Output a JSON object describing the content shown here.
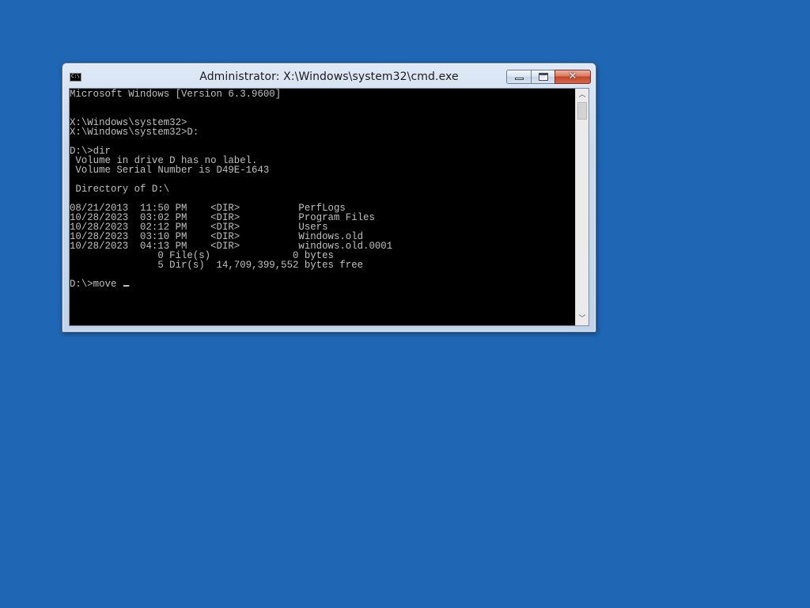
{
  "window": {
    "title": "Administrator: X:\\Windows\\system32\\cmd.exe",
    "icon": "cmd-icon",
    "icon_text": "C:\\",
    "buttons": {
      "minimize": "minimize-icon",
      "maximize": "maximize-icon",
      "close": "close-icon",
      "close_glyph": "✕"
    }
  },
  "console": {
    "text": "Microsoft Windows [Version 6.3.9600]\n\n\nX:\\Windows\\system32>\nX:\\Windows\\system32>D:\n\nD:\\>dir\n Volume in drive D has no label.\n Volume Serial Number is D49E-1643\n\n Directory of D:\\\n\n08/21/2013  11:50 PM    <DIR>          PerfLogs\n10/28/2023  03:02 PM    <DIR>          Program Files\n10/28/2023  02:12 PM    <DIR>          Users\n10/28/2023  03:10 PM    <DIR>          Windows.old\n10/28/2023  04:13 PM    <DIR>          windows.old.0001\n               0 File(s)              0 bytes\n               5 Dir(s)  14,709,399,552 bytes free\n\n",
    "prompt": "D:\\>",
    "typed": "move ",
    "colors": {
      "background": "#000000",
      "foreground": "#c0c0c0"
    }
  },
  "scrollbar": {
    "up_glyph": "︿",
    "down_glyph": "﹀"
  },
  "desktop": {
    "background_color": "#1f66b4"
  }
}
